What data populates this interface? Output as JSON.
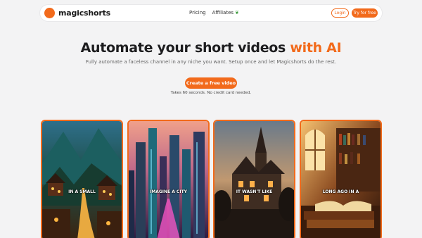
{
  "nav": {
    "brand": "magicshorts",
    "links": [
      "Pricing",
      "Affiliates"
    ],
    "affiliates_icon": "leaf-icon",
    "login": "Login",
    "try_free": "Try for free"
  },
  "hero": {
    "title_main": "Automate your short videos",
    "title_accent": "with AI",
    "subtitle": "Fully automate a faceless channel in any niche you want. Setup once and let Magicshorts do the rest.",
    "cta": "Create a free video",
    "note": "Takes 60 seconds. No credit card needed."
  },
  "cards": [
    {
      "caption": "IN A SMALL"
    },
    {
      "caption": "IMAGINE A CITY"
    },
    {
      "caption": "IT WASN'T LIKE"
    },
    {
      "caption": "LONG AGO IN A"
    }
  ],
  "colors": {
    "accent": "#f26a1b",
    "background": "#f3f3f4"
  }
}
